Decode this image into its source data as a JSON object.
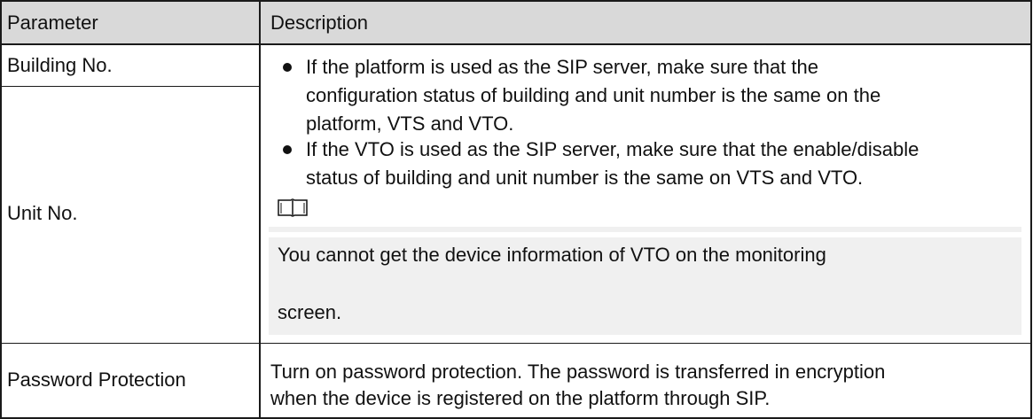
{
  "table": {
    "headers": {
      "parameter": "Parameter",
      "description": "Description"
    },
    "rows": {
      "building_no": "Building No.",
      "unit_no": "Unit No.",
      "password_protection": "Password Protection"
    },
    "bullets": [
      {
        "lines": [
          "If the platform is used as the SIP server, make sure that the",
          "configuration status of building and unit number is the same on the",
          "platform, VTS and VTO."
        ]
      },
      {
        "lines": [
          "If the VTO is used as the SIP server, make sure that the enable/disable",
          "status of building and unit number is the same on VTS and VTO."
        ]
      }
    ],
    "note": {
      "icon": "book-icon",
      "lines": [
        "You cannot get the device information of VTO on the monitoring",
        "screen."
      ]
    },
    "password_description": [
      "Turn on password protection. The password is transferred in encryption",
      "when the device is registered on the platform through SIP."
    ]
  }
}
